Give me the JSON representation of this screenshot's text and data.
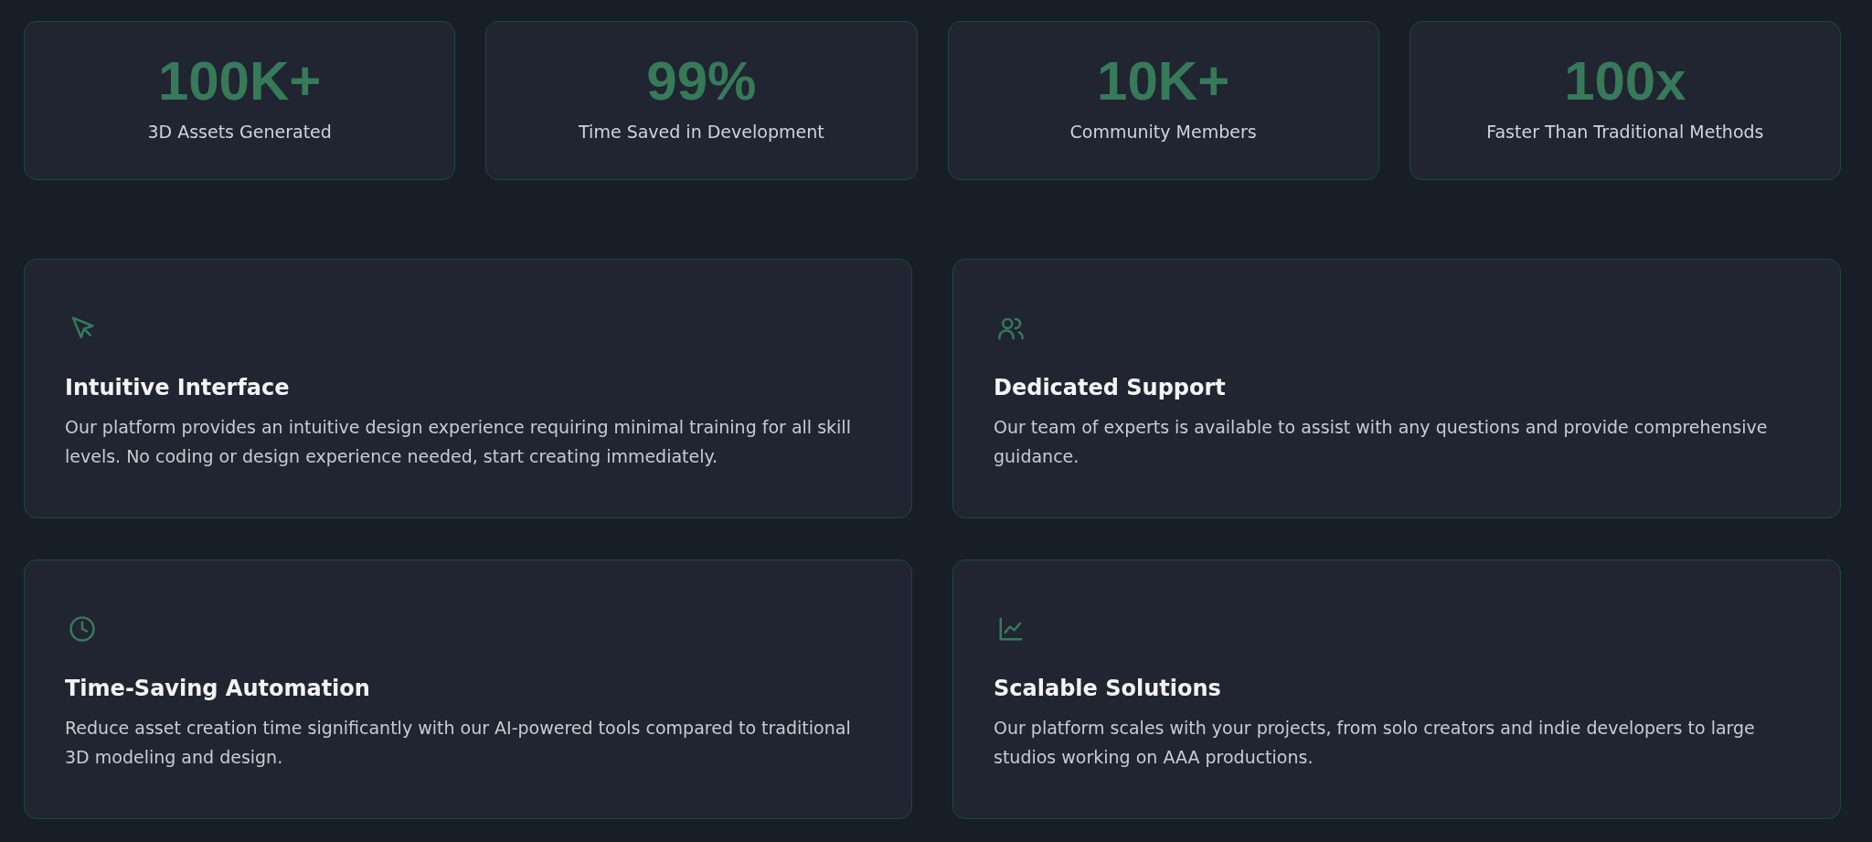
{
  "stats": [
    {
      "value": "100K+",
      "label": "3D Assets Generated"
    },
    {
      "value": "99%",
      "label": "Time Saved in Development"
    },
    {
      "value": "10K+",
      "label": "Community Members"
    },
    {
      "value": "100x",
      "label": "Faster Than Traditional Methods"
    }
  ],
  "features": [
    {
      "title": "Intuitive Interface",
      "description": "Our platform provides an intuitive design experience requiring minimal training for all skill levels. No coding or design experience needed, start creating immediately."
    },
    {
      "title": "Dedicated Support",
      "description": "Our team of experts is available to assist with any questions and provide comprehensive guidance."
    },
    {
      "title": "Time-Saving Automation",
      "description": "Reduce asset creation time significantly with our AI-powered tools compared to traditional 3D modeling and design."
    },
    {
      "title": "Scalable Solutions",
      "description": "Our platform scales with your projects, from solo creators and indie developers to large studios working on AAA productions."
    }
  ]
}
